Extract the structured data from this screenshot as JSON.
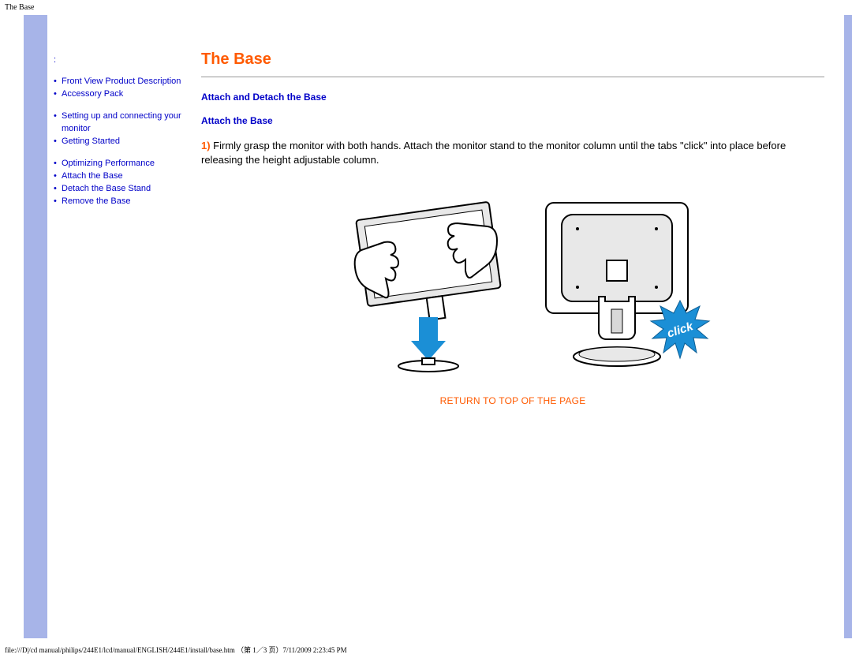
{
  "top_label": "The Base",
  "footer_path": "file:///D|/cd manual/philips/244E1/lcd/manual/ENGLISH/244E1/install/base.htm （第 1／3 页）7/11/2009 2:23:45 PM",
  "sidebar": {
    "colon": ":",
    "groups": [
      [
        {
          "label": "Front View Product Description"
        },
        {
          "label": "Accessory Pack"
        }
      ],
      [
        {
          "label": "Setting up and connecting your monitor"
        },
        {
          "label": "Getting Started"
        }
      ],
      [
        {
          "label": "Optimizing Performance"
        },
        {
          "label": "Attach the Base"
        },
        {
          "label": "Detach the Base Stand"
        },
        {
          "label": "Remove the Base"
        }
      ]
    ]
  },
  "content": {
    "title": "The Base",
    "section1": "Attach and Detach the Base",
    "section2": "Attach the Base",
    "step_num": "1)",
    "step_text": " Firmly grasp the monitor with both hands. Attach the monitor stand to the monitor column until the tabs \"click\" into place before releasing the height adjustable column.",
    "click_label": "click",
    "return_link": "RETURN TO TOP OF THE PAGE"
  }
}
